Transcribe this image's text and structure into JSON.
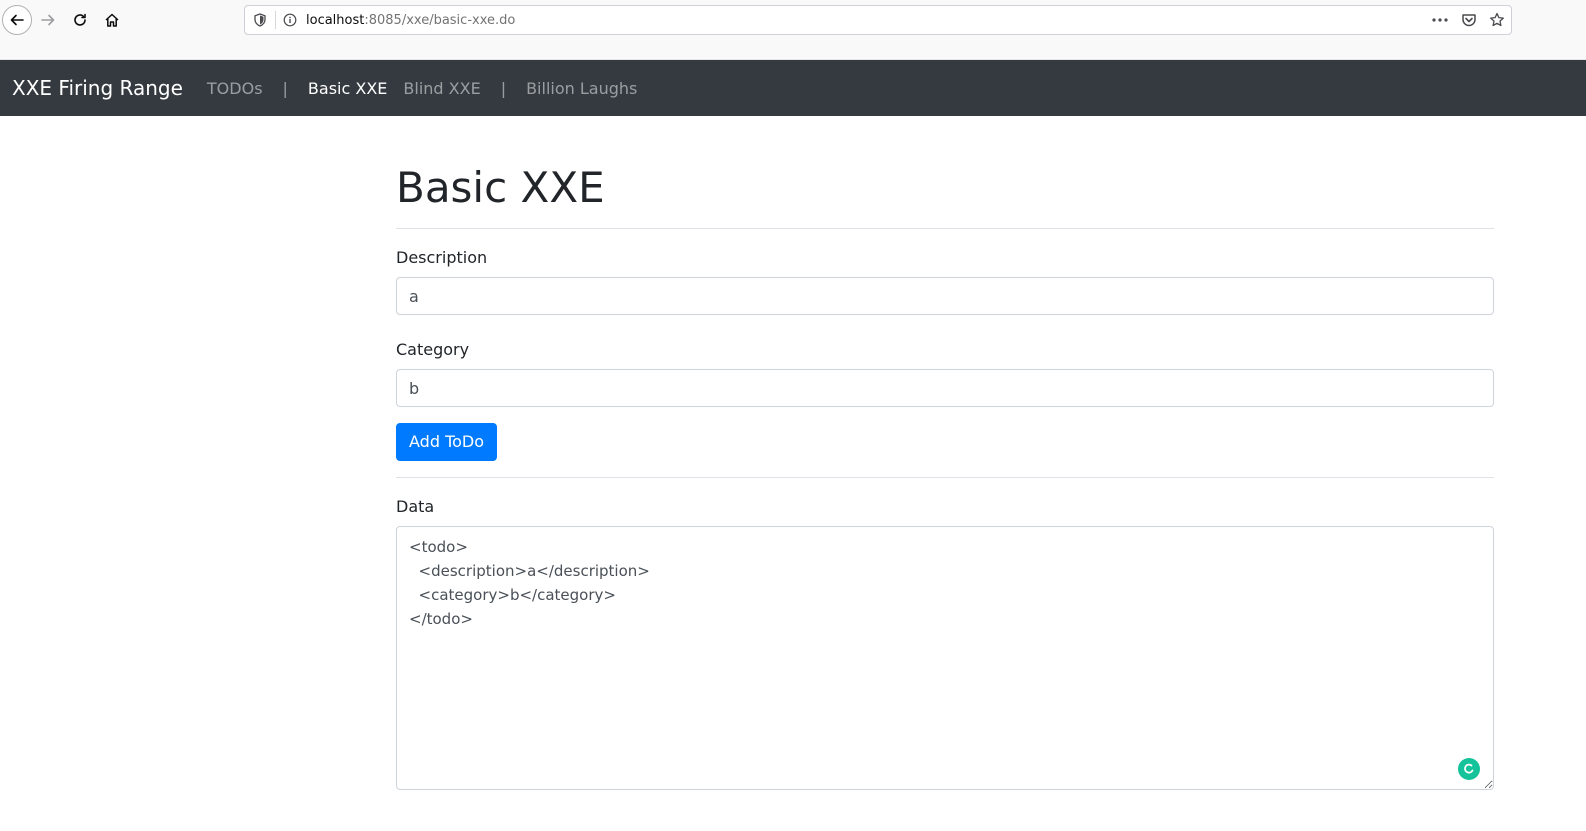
{
  "browser": {
    "url_host": "localhost",
    "url_rest": ":8085/xxe/basic-xxe.do"
  },
  "navbar": {
    "brand": "XXE Firing Range",
    "links": [
      {
        "label": "TODOs"
      },
      {
        "label": "Basic XXE"
      },
      {
        "label": "Blind XXE"
      },
      {
        "label": "Billion Laughs"
      }
    ],
    "separator": "|"
  },
  "main": {
    "title": "Basic XXE",
    "description_label": "Description",
    "description_value": "a",
    "category_label": "Category",
    "category_value": "b",
    "add_button": "Add ToDo",
    "data_label": "Data",
    "data_value": "<todo>\n  <description>a</description>\n  <category>b</category>\n</todo>"
  },
  "colors": {
    "navbar_bg": "#343a40",
    "primary": "#007bff",
    "grammarly": "#15c39a"
  },
  "icons": [
    "back-arrow-icon",
    "forward-arrow-icon",
    "reload-icon",
    "home-icon",
    "shield-icon",
    "info-icon",
    "more-icon",
    "pocket-icon",
    "bookmark-star-icon",
    "grammarly-icon"
  ]
}
